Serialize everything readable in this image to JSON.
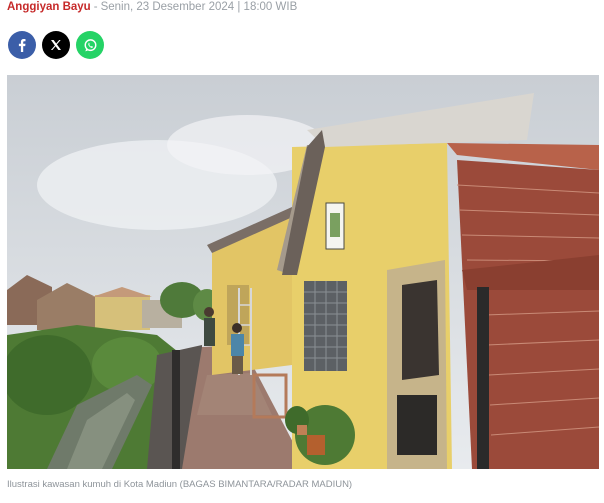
{
  "article": {
    "author": "Anggiyan Bayu",
    "separator": "-",
    "date": "Senin, 23 Desember 2024 | 18:00 WIB"
  },
  "share": {
    "buttons": [
      {
        "icon": "facebook-icon",
        "color": "#3b5ea8"
      },
      {
        "icon": "x-icon",
        "color": "#000000"
      },
      {
        "icon": "whatsapp-icon",
        "color": "#25d366"
      }
    ]
  },
  "photo": {
    "caption": "Ilustrasi kawasan kumuh di Kota Madiun (BAGAS BIMANTARA/RADAR MADIUN)"
  },
  "colors": {
    "author": "#c62a2a",
    "meta": "#9aa0a6",
    "caption": "#8e949a"
  }
}
